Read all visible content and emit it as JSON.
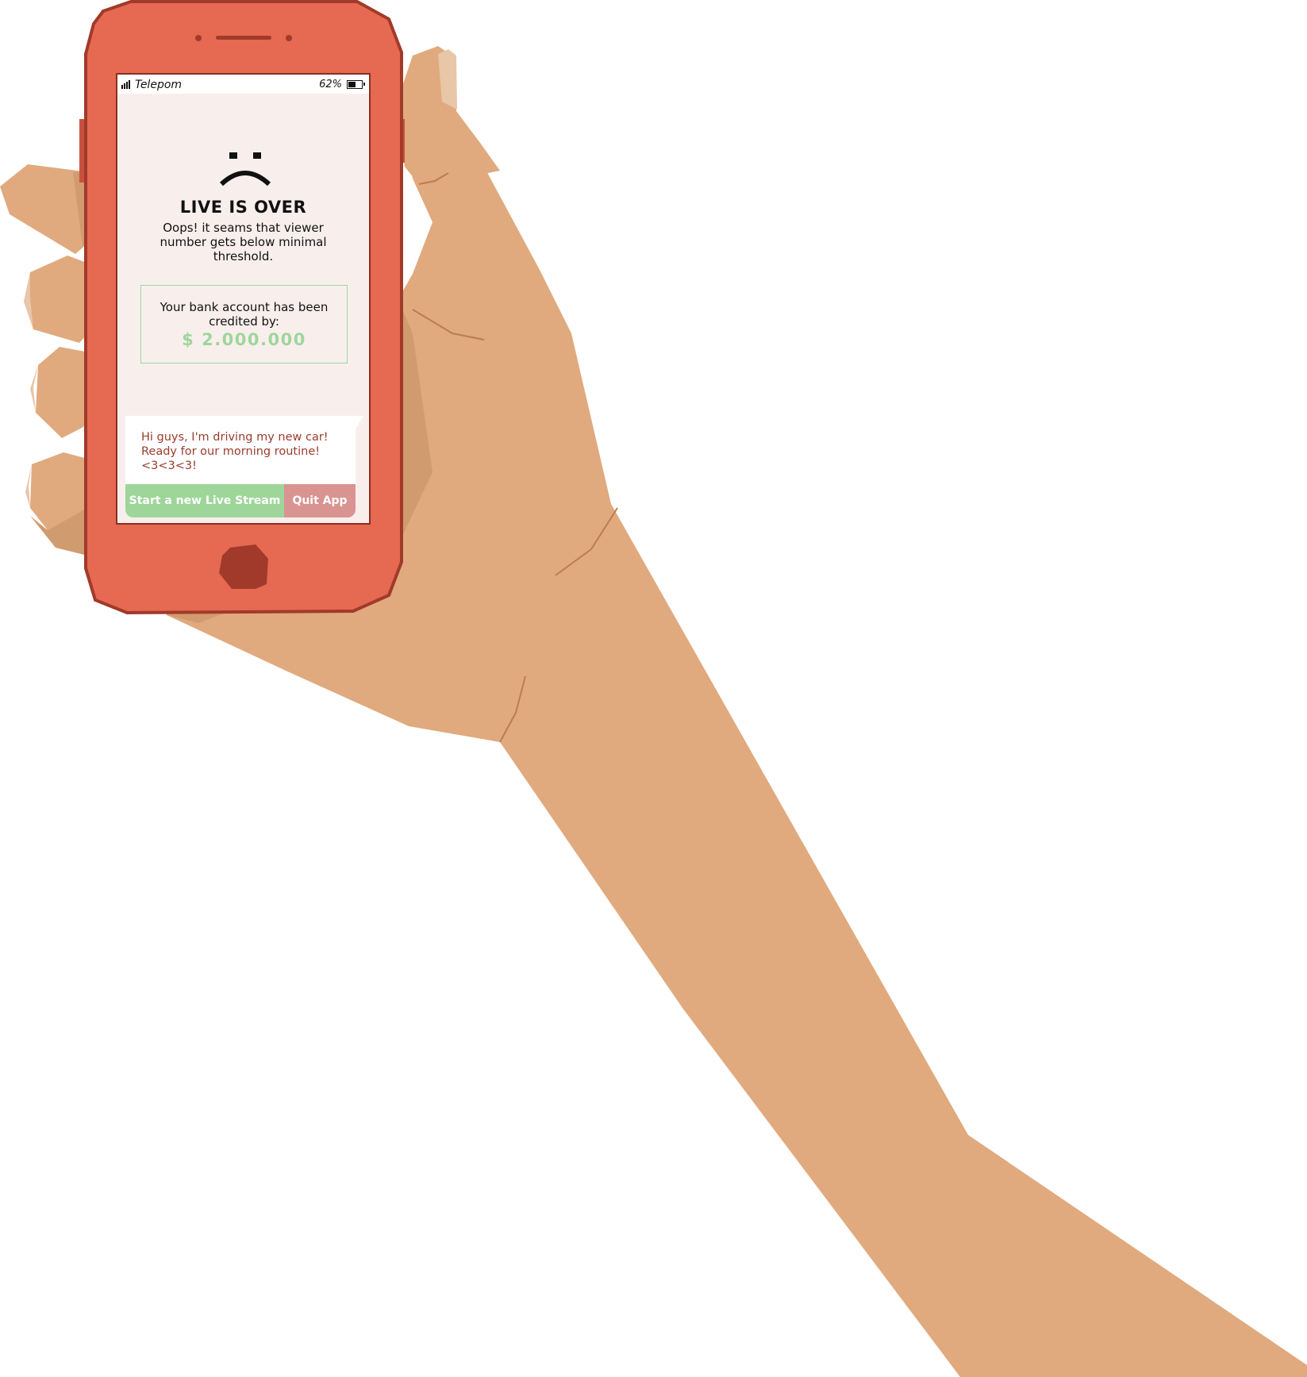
{
  "colors": {
    "skin": "#e0aa7e",
    "skin_shadow": "#d19b70",
    "skin_crease": "#b97e4f",
    "phone_body": "#e66951",
    "phone_outline": "#a13a2a",
    "screen_bg": "#f8efed",
    "accent_green": "#9ed69a",
    "accent_red": "#d99391",
    "chat_text": "#9a3c2c"
  },
  "status_bar": {
    "carrier": "Telepom",
    "battery_percent": "62%",
    "battery_level": 0.62,
    "signal_icon": "signal-bars-icon",
    "battery_icon": "battery-icon"
  },
  "screen": {
    "face_icon": "sad-face-icon",
    "title": "LIVE IS OVER",
    "message": "Oops! it seams that viewer number gets below minimal threshold.",
    "credit": {
      "label": "Your bank account has been credited by:",
      "amount": "$ 2.000.000"
    },
    "chat": {
      "text": "Hi guys, I'm driving my new car! Ready for our morning routine! <3<3<3!"
    },
    "buttons": {
      "start_label": "Start a new Live Stream",
      "quit_label": "Quit App"
    }
  }
}
